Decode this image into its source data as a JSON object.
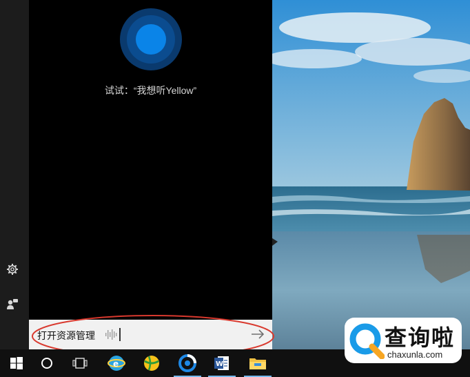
{
  "cortana": {
    "suggestion_prefix": "试试：",
    "suggestion_text": "“我想听Yellow”"
  },
  "search": {
    "query": "打开资源管理"
  },
  "sidebar": {
    "icons": [
      "settings-icon",
      "feedback-icon"
    ]
  },
  "taskbar": {
    "items": [
      "windows-start-icon",
      "cortana-circle-icon",
      "task-view-icon",
      "browser-app-icon",
      "ball-app-icon",
      "chrome-like-browser-icon",
      "word-icon",
      "file-explorer-icon"
    ]
  },
  "watermark": {
    "title": "查询啦",
    "url": "chaxunla.com"
  },
  "colors": {
    "cortana_blue": "#0078d7",
    "cortana_dark_blue": "#0a3a6e",
    "highlight_red": "#d9392e",
    "taskbar_bg": "#101010"
  }
}
